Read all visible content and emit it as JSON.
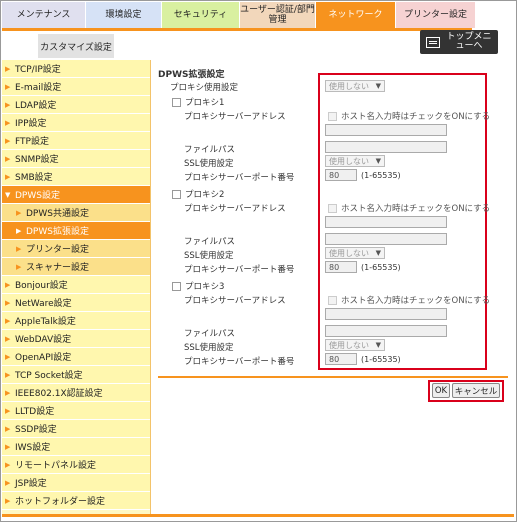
{
  "tabs": [
    "メンテナンス",
    "環境設定",
    "セキュリティ",
    "ユーザー認証/部門管理",
    "ネットワーク",
    "プリンター設定"
  ],
  "subtab": "カスタマイズ設定",
  "topmenu": "トップメニューへ",
  "sidebar": [
    {
      "label": "TCP/IP設定",
      "type": "item"
    },
    {
      "label": "E-mail設定",
      "type": "item"
    },
    {
      "label": "LDAP設定",
      "type": "item"
    },
    {
      "label": "IPP設定",
      "type": "item"
    },
    {
      "label": "FTP設定",
      "type": "item"
    },
    {
      "label": "SNMP設定",
      "type": "item"
    },
    {
      "label": "SMB設定",
      "type": "item"
    },
    {
      "label": "DPWS設定",
      "type": "open"
    },
    {
      "label": "DPWS共通設定",
      "type": "sub"
    },
    {
      "label": "DPWS拡張設定",
      "type": "sub-active"
    },
    {
      "label": "プリンター設定",
      "type": "sub"
    },
    {
      "label": "スキャナー設定",
      "type": "sub"
    },
    {
      "label": "Bonjour設定",
      "type": "item"
    },
    {
      "label": "NetWare設定",
      "type": "item"
    },
    {
      "label": "AppleTalk設定",
      "type": "item"
    },
    {
      "label": "WebDAV設定",
      "type": "item"
    },
    {
      "label": "OpenAPI設定",
      "type": "item"
    },
    {
      "label": "TCP Socket設定",
      "type": "item"
    },
    {
      "label": "IEEE802.1X認証設定",
      "type": "item"
    },
    {
      "label": "LLTD設定",
      "type": "item"
    },
    {
      "label": "SSDP設定",
      "type": "item"
    },
    {
      "label": "IWS設定",
      "type": "item"
    },
    {
      "label": "リモートパネル設定",
      "type": "item"
    },
    {
      "label": "JSP設定",
      "type": "item"
    },
    {
      "label": "ホットフォルダー設定",
      "type": "item"
    }
  ],
  "main": {
    "title": "DPWS拡張設定",
    "proxy_use_label": "プロキシ使用設定",
    "proxy_use_value": "使用しない",
    "proxies": [
      {
        "name": "プロキシ1",
        "address_label": "プロキシサーバーアドレス",
        "hostname_check": "ホスト名入力時はチェックをONにする",
        "filepath_label": "ファイルパス",
        "ssl_label": "SSL使用設定",
        "ssl_value": "使用しない",
        "port_label": "プロキシサーバーポート番号",
        "port_value": "80",
        "range": "(1-65535)"
      },
      {
        "name": "プロキシ2",
        "address_label": "プロキシサーバーアドレス",
        "hostname_check": "ホスト名入力時はチェックをONにする",
        "filepath_label": "ファイルパス",
        "ssl_label": "SSL使用設定",
        "ssl_value": "使用しない",
        "port_label": "プロキシサーバーポート番号",
        "port_value": "80",
        "range": "(1-65535)"
      },
      {
        "name": "プロキシ3",
        "address_label": "プロキシサーバーアドレス",
        "hostname_check": "ホスト名入力時はチェックをONにする",
        "filepath_label": "ファイルパス",
        "ssl_label": "SSL使用設定",
        "ssl_value": "使用しない",
        "port_label": "プロキシサーバーポート番号",
        "port_value": "80",
        "range": "(1-65535)"
      }
    ],
    "ok_label": "OK",
    "cancel_label": "キャンセル"
  },
  "colors": {
    "accent": "#f7931e",
    "highlight": "#d9001b"
  }
}
